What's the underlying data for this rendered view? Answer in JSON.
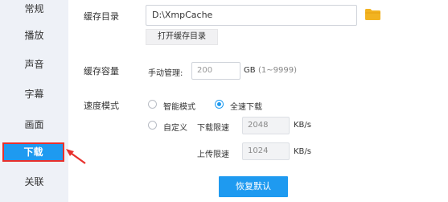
{
  "sidebar": {
    "items": [
      {
        "label": "常规"
      },
      {
        "label": "播放"
      },
      {
        "label": "声音"
      },
      {
        "label": "字幕"
      },
      {
        "label": "画面"
      },
      {
        "label": "下载",
        "active": true
      },
      {
        "label": "关联"
      }
    ]
  },
  "cache_dir": {
    "label": "缓存目录",
    "path": "D:\\XmpCache",
    "open_button": "打开缓存目录"
  },
  "cache_size": {
    "label": "缓存容量",
    "manual_label": "手动管理:",
    "value": "200",
    "unit": "GB",
    "range": "(1~9999)"
  },
  "speed_mode": {
    "label": "速度模式",
    "option_smart": "智能模式",
    "option_full": "全速下载",
    "option_custom": "自定义",
    "selected": "全速下载",
    "download_limit_label": "下载限速",
    "download_limit_value": "2048",
    "download_unit": "KB/s",
    "upload_limit_label": "上传限速",
    "upload_limit_value": "1024",
    "upload_unit": "KB/s"
  },
  "reset_button": "恢复默认",
  "colors": {
    "accent": "#1e9af0",
    "highlight": "#e8302c",
    "sidebar_bg": "#eef1f7",
    "folder": "#f2b321"
  }
}
